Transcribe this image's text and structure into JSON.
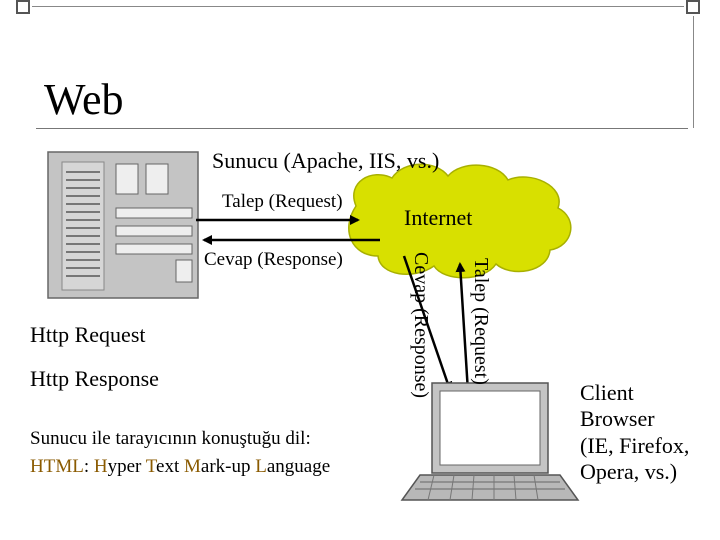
{
  "title": "Web",
  "server_label": "Sunucu (Apache, IIS, vs.)",
  "request_top": "Talep (Request)",
  "response_top": "Cevap (Response)",
  "internet_label": "Internet",
  "request_diag": "Talep (Request)",
  "response_diag": "Cevap (Response)",
  "http_request": "Http Request",
  "http_response": "Http Response",
  "language_line1": "Sunucu ile tarayıcının konuştuğu dil:",
  "language_line2": {
    "html": "HTML",
    "sep": ": ",
    "h": "H",
    "yper": "yper ",
    "t": "T",
    "ext": "ext ",
    "m": "M",
    "ark": "ark-up ",
    "l": "L",
    "anguage": "anguage"
  },
  "client_label": "Client\nBrowser\n(IE, Firefox,\nOpera, vs.)",
  "colors": {
    "cloud": "#d8e000",
    "cloud_stroke": "#a8b000",
    "accent": "#8a5a00",
    "arrow": "#000000"
  }
}
